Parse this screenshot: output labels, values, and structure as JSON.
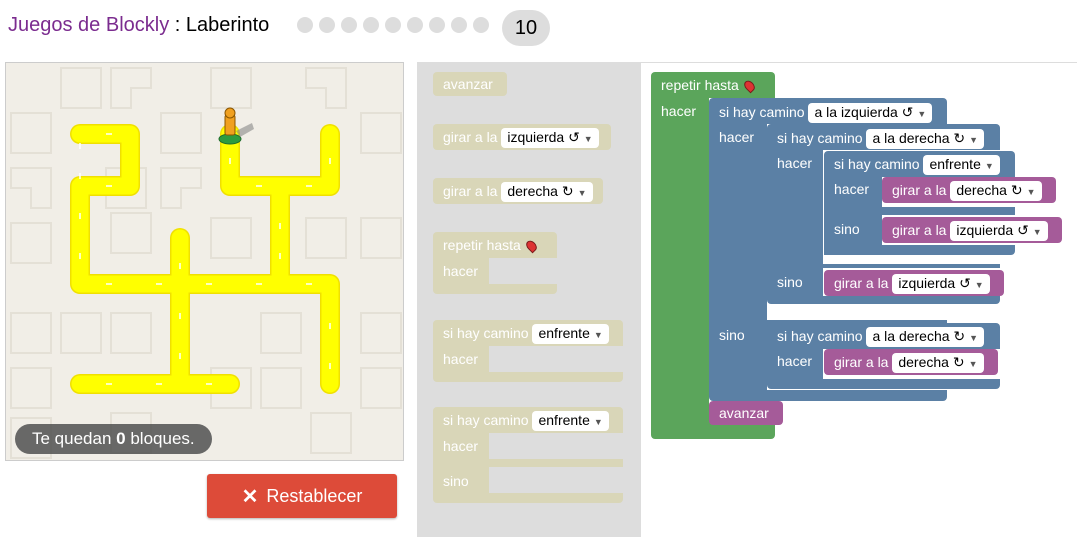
{
  "header": {
    "app_title": "Juegos de Blockly",
    "separator": ":",
    "page_title": "Laberinto",
    "level_number": "10"
  },
  "status": {
    "prefix": "Te quedan",
    "count": "0",
    "suffix": "bloques."
  },
  "reset_label": "Restablecer",
  "toolbox": {
    "avanzar": "avanzar",
    "girar_izq": {
      "label": "girar a la",
      "value": "izquierda ↺"
    },
    "girar_der": {
      "label": "girar a la",
      "value": "derecha ↻"
    },
    "repetir": {
      "label": "repetir hasta",
      "hacer": "hacer"
    },
    "si": {
      "label": "si hay camino",
      "value": "enfrente",
      "hacer": "hacer"
    },
    "si_sino": {
      "label": "si hay camino",
      "value": "enfrente",
      "hacer": "hacer",
      "sino": "sino"
    }
  },
  "workspace": {
    "repetir": "repetir hasta",
    "hacer": "hacer",
    "sino": "sino",
    "si": "si hay camino",
    "izq_dir": "a la izquierda ↺",
    "der_dir": "a la derecha ↻",
    "enfrente": "enfrente",
    "girar": "girar a la",
    "derecha": "derecha ↻",
    "izquierda": "izquierda ↺",
    "avanzar": "avanzar"
  },
  "colors": {
    "accent_purple": "#7b2c8f",
    "reset": "#dd4b39",
    "loop": "#5ba55b",
    "logic": "#5b80a5",
    "action": "#a55b99",
    "path": "#ffff00"
  }
}
